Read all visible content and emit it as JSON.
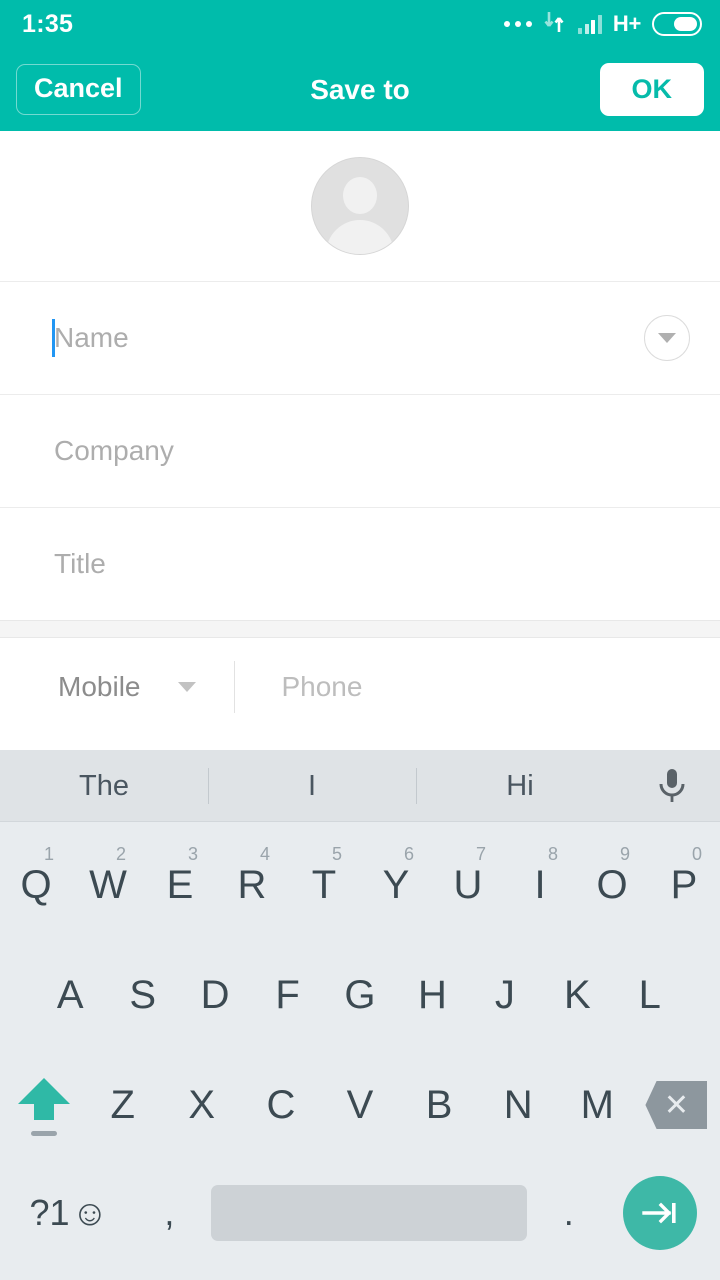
{
  "status_bar": {
    "time": "1:35",
    "network_type": "H+",
    "icons": [
      "more-dots-icon",
      "data-sync-icon",
      "signal-bars-icon",
      "battery-icon"
    ]
  },
  "app_bar": {
    "cancel_label": "Cancel",
    "title": "Save to",
    "ok_label": "OK",
    "accent_color": "#00BCAB",
    "ok_text_color": "#06BBAA"
  },
  "contact_form": {
    "avatar_icon": "person-placeholder-icon",
    "fields": [
      {
        "placeholder": "Name",
        "value": "",
        "focused": true,
        "has_expand": true
      },
      {
        "placeholder": "Company",
        "value": "",
        "focused": false,
        "has_expand": false
      },
      {
        "placeholder": "Title",
        "value": "",
        "focused": false,
        "has_expand": false
      }
    ],
    "caret_color": "#2196F3",
    "phone_row": {
      "type_label": "Mobile",
      "placeholder": "Phone"
    }
  },
  "keyboard": {
    "suggestions": [
      "The",
      "I",
      "Hi"
    ],
    "mic_icon": "microphone-icon",
    "row1": [
      {
        "letter": "Q",
        "num": "1"
      },
      {
        "letter": "W",
        "num": "2"
      },
      {
        "letter": "E",
        "num": "3"
      },
      {
        "letter": "R",
        "num": "4"
      },
      {
        "letter": "T",
        "num": "5"
      },
      {
        "letter": "Y",
        "num": "6"
      },
      {
        "letter": "U",
        "num": "7"
      },
      {
        "letter": "I",
        "num": "8"
      },
      {
        "letter": "O",
        "num": "9"
      },
      {
        "letter": "P",
        "num": "0"
      }
    ],
    "row2": [
      "A",
      "S",
      "D",
      "F",
      "G",
      "H",
      "J",
      "K",
      "L"
    ],
    "row3": [
      "Z",
      "X",
      "C",
      "V",
      "B",
      "N",
      "M"
    ],
    "shift_icon": "shift-caps-lock-icon",
    "backspace_icon": "backspace-icon",
    "backspace_glyph": "✕",
    "symbols_label": "?1",
    "emoji_glyph": "☺",
    "comma": ",",
    "period": ".",
    "space_label": "",
    "enter_icon": "tab-next-icon",
    "shift_color": "#2FB9A6",
    "enter_color": "#3EB8A7",
    "background": "#E8ECEF",
    "suggestion_background": "#DFE3E6"
  }
}
